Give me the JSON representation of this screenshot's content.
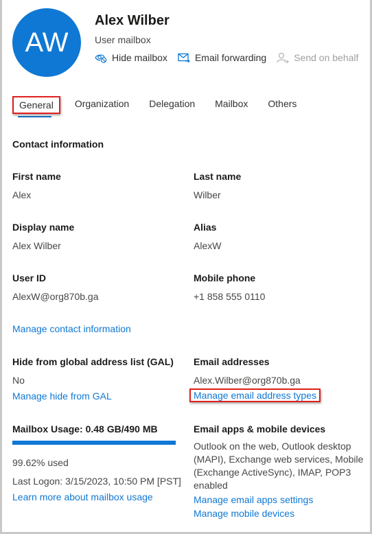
{
  "header": {
    "avatar_initials": "AW",
    "name": "Alex Wilber",
    "subtitle": "User mailbox",
    "actions": [
      {
        "label": "Hide mailbox",
        "icon": "hide-eye-icon",
        "enabled": true
      },
      {
        "label": "Email forwarding",
        "icon": "mail-forward-icon",
        "enabled": true
      },
      {
        "label": "Send on behalf",
        "icon": "person-arrow-icon",
        "enabled": false
      }
    ]
  },
  "tabs": [
    {
      "label": "General",
      "selected": true
    },
    {
      "label": "Organization",
      "selected": false
    },
    {
      "label": "Delegation",
      "selected": false
    },
    {
      "label": "Mailbox",
      "selected": false
    },
    {
      "label": "Others",
      "selected": false
    }
  ],
  "contact": {
    "section_title": "Contact information",
    "first_name": {
      "label": "First name",
      "value": "Alex"
    },
    "last_name": {
      "label": "Last name",
      "value": "Wilber"
    },
    "display_name": {
      "label": "Display name",
      "value": "Alex Wilber"
    },
    "alias": {
      "label": "Alias",
      "value": "AlexW"
    },
    "user_id": {
      "label": "User ID",
      "value": "AlexW@org870b.ga"
    },
    "mobile_phone": {
      "label": "Mobile phone",
      "value": "+1 858 555 0110"
    },
    "manage_link": "Manage contact information"
  },
  "gal": {
    "label": "Hide from global address list (GAL)",
    "value": "No",
    "manage_link": "Manage hide from GAL"
  },
  "email_addresses": {
    "label": "Email addresses",
    "value": "Alex.Wilber@org870b.ga",
    "manage_link": "Manage email address types"
  },
  "mailbox_usage": {
    "label": "Mailbox Usage: 0.48 GB/490 MB",
    "percent_used": 99.62,
    "used_text": "99.62% used",
    "last_logon": "Last Logon: 3/15/2023, 10:50 PM [PST]",
    "learn_link": "Learn more about mailbox usage"
  },
  "email_apps": {
    "label": "Email apps & mobile devices",
    "description": "Outlook on the web, Outlook desktop (MAPI), Exchange web services, Mobile (Exchange ActiveSync), IMAP, POP3 enabled",
    "manage_apps_link": "Manage email apps settings",
    "manage_devices_link": "Manage mobile devices"
  },
  "colors": {
    "accent": "#0f78d4",
    "highlight_box": "#e01e1e"
  }
}
